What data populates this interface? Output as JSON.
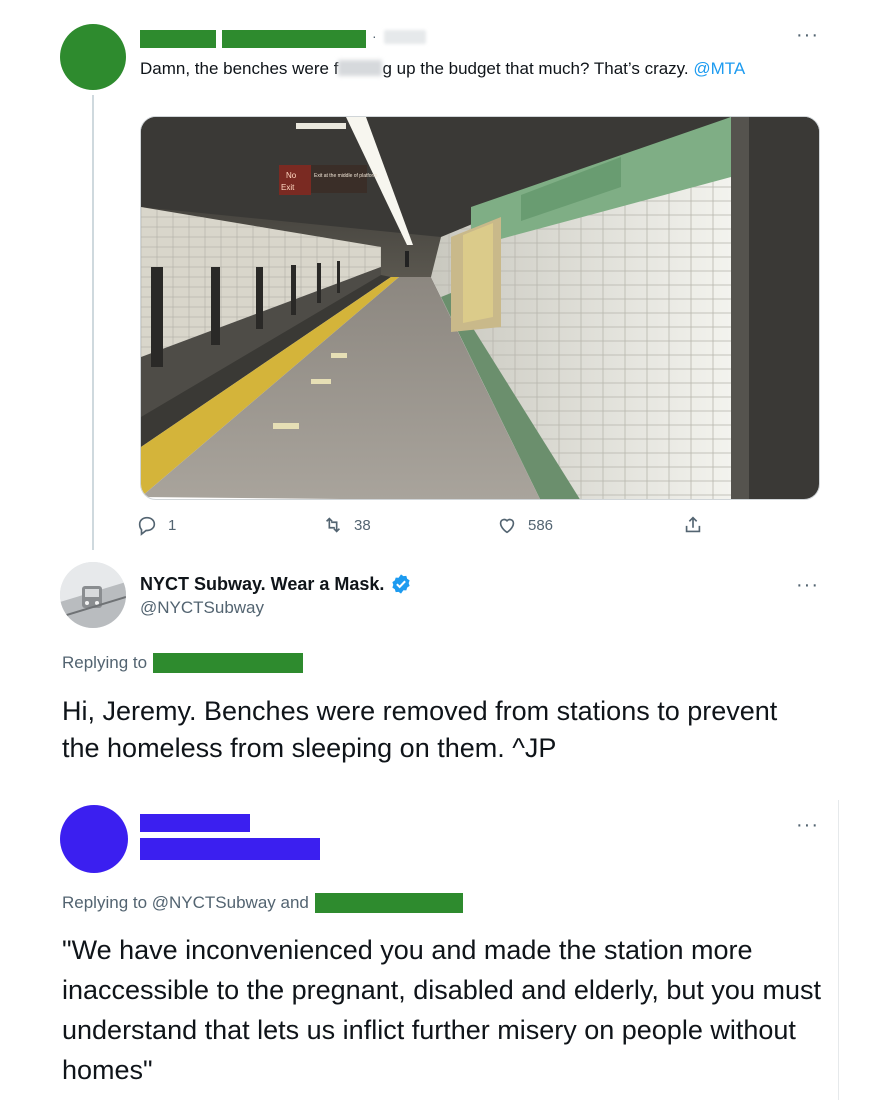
{
  "tweet1": {
    "text_before_blur": "Damn, the benches were f",
    "text_after_blur": "g up the budget that much? That’s crazy.",
    "mention": "@MTA",
    "more_label": "···",
    "separator": "·",
    "photo_signs": {
      "no": "No",
      "exit": "Exit",
      "sign_right": "Exit at the middle of platform"
    },
    "actions": {
      "replies": "1",
      "retweets": "38",
      "likes": "586"
    },
    "colors": {
      "redaction": "#2e8b2e",
      "link": "#1d9bf0"
    }
  },
  "tweet2": {
    "display_name": "NYCT Subway. Wear a Mask.",
    "handle": "@NYCTSubway",
    "replying_to": "Replying to",
    "text": "Hi, Jeremy. Benches were removed from stations to prevent the homeless from sleeping on them. ^JP",
    "more_label": "···",
    "verified_icon": "verified-badge-icon",
    "colors": {
      "verified": "#1d9bf0"
    }
  },
  "tweet3": {
    "replying_to": "Replying to @NYCTSubway and",
    "text": "\"We have inconvenienced you and made the station more inaccessible to the pregnant, disabled and elderly, but you must understand that lets us inflict further misery on people without homes\"",
    "more_label": "···",
    "colors": {
      "redaction": "#3b1ff0"
    }
  }
}
